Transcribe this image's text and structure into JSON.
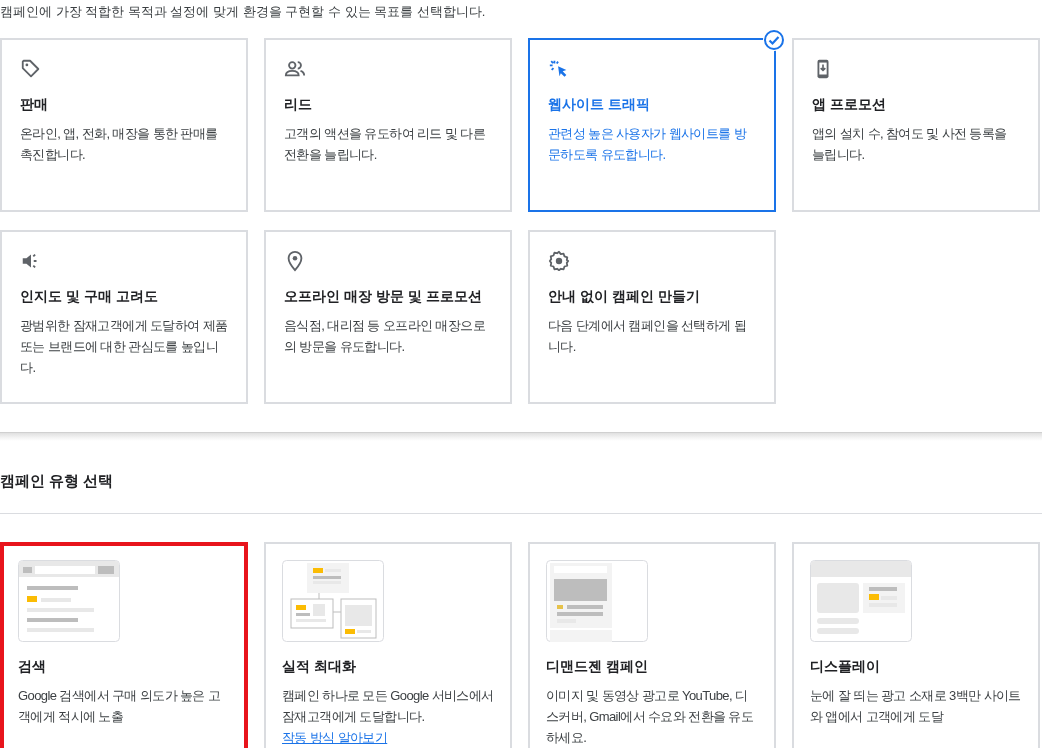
{
  "intro": "캠페인에 가장 적합한 목적과 설정에 맞게 환경을 구현할 수 있는 목표를 선택합니다.",
  "goals": [
    {
      "kind": "tag",
      "title": "판매",
      "description": "온라인, 앱, 전화, 매장을 통한 판매를 촉진합니다.",
      "selected": false
    },
    {
      "kind": "people",
      "title": "리드",
      "description": "고객의 액션을 유도하여 리드 및 다른 전환을 늘립니다.",
      "selected": false
    },
    {
      "kind": "click",
      "title": "웹사이트 트래픽",
      "description": "관련성 높은 사용자가 웹사이트를 방문하도록 유도합니다.",
      "selected": true
    },
    {
      "kind": "phone",
      "title": "앱 프로모션",
      "description": "앱의 설치 수, 참여도 및 사전 등록을 늘립니다.",
      "selected": false
    },
    {
      "kind": "speaker",
      "title": "인지도 및 구매 고려도",
      "description": "광범위한 잠재고객에게 도달하여 제품 또는 브랜드에 대한 관심도를 높입니다.",
      "selected": false
    },
    {
      "kind": "pin",
      "title": "오프라인 매장 방문 및 프로모션",
      "description": "음식점, 대리점 등 오프라인 매장으로의 방문을 유도합니다.",
      "selected": false
    },
    {
      "kind": "gear",
      "title": "안내 없이 캠페인 만들기",
      "description": "다음 단계에서 캠페인을 선택하게 됩니다.",
      "selected": false
    }
  ],
  "campaign_types": {
    "heading": "캠페인 유형 선택",
    "items": [
      {
        "kind": "search",
        "title": "검색",
        "description": "Google 검색에서 구매 의도가 높은 고객에게 적시에 노출",
        "highlighted": true
      },
      {
        "kind": "performance_max",
        "title": "실적 최대화",
        "description": "캠페인 하나로 모든 Google 서비스에서 잠재고객에게 도달합니다.",
        "link": "작동 방식 알아보기",
        "highlighted": false
      },
      {
        "kind": "discovery",
        "title": "디맨드젠 캠페인",
        "description": "이미지 및 동영상 광고로 YouTube, 디스커버, Gmail에서 수요와 전환을 유도하세요.",
        "highlighted": false
      },
      {
        "kind": "display",
        "title": "디스플레이",
        "description": "눈에 잘 띄는 광고 소재로 3백만 사이트와 앱에서 고객에게 도달",
        "highlighted": false
      }
    ]
  }
}
